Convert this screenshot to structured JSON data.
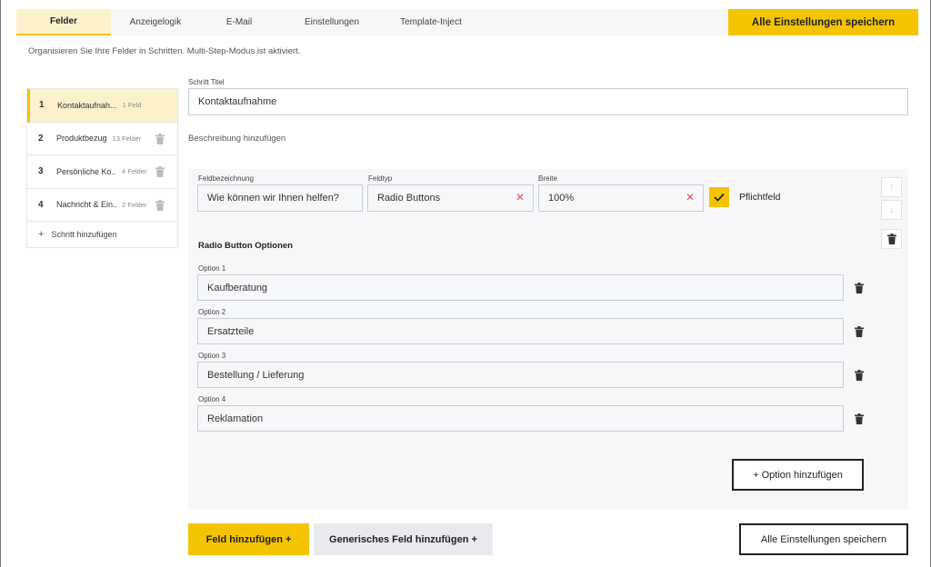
{
  "tabs": [
    {
      "label": "Felder",
      "active": true
    },
    {
      "label": "Anzeigelogik"
    },
    {
      "label": "E-Mail"
    },
    {
      "label": "Einstellungen"
    },
    {
      "label": "Template-Inject"
    }
  ],
  "header": {
    "save_label": "Alle Einstellungen speichern"
  },
  "intro_text": "Organisieren Sie Ihre Felder in Schritten. Multi-Step-Modus ist aktiviert.",
  "steps": [
    {
      "num": "1",
      "name": "Kontaktaufnah...",
      "count": "1 Feld",
      "active": true
    },
    {
      "num": "2",
      "name": "Produktbezug",
      "count": "13 Felder"
    },
    {
      "num": "3",
      "name": "Persönliche Ko...",
      "count": "4 Felder"
    },
    {
      "num": "4",
      "name": "Nachricht & Ein...",
      "count": "2 Felder"
    }
  ],
  "add_step_label": "Schritt hinzufügen",
  "step_editor": {
    "title_label": "Schritt Titel",
    "title_value": "Kontaktaufnahme",
    "description_link": "Beschreibung hinzufügen"
  },
  "field": {
    "label_caption": "Feldbezeichnung",
    "label_value": "Wie können wir Ihnen helfen?",
    "type_caption": "Feldtyp",
    "type_value": "Radio Buttons",
    "width_caption": "Breite",
    "width_value": "100%",
    "required_label": "Pflichtfeld",
    "required_checked": true
  },
  "radio_options": {
    "title": "Radio Button Optionen",
    "items": [
      {
        "label": "Option 1",
        "value": "Kaufberatung"
      },
      {
        "label": "Option 2",
        "value": "Ersatzteile"
      },
      {
        "label": "Option 3",
        "value": "Bestellung / Lieferung"
      },
      {
        "label": "Option 4",
        "value": "Reklamation"
      }
    ],
    "add_label": "+ Option hinzufügen"
  },
  "footer": {
    "add_field_label": "Feld hinzufügen +",
    "add_generic_label": "Generisches Feld hinzufügen +",
    "save_label": "Alle Einstellungen speichern"
  },
  "colors": {
    "accent": "#f5c400",
    "accent_light": "#fbf2cc",
    "clear": "#e05555"
  }
}
